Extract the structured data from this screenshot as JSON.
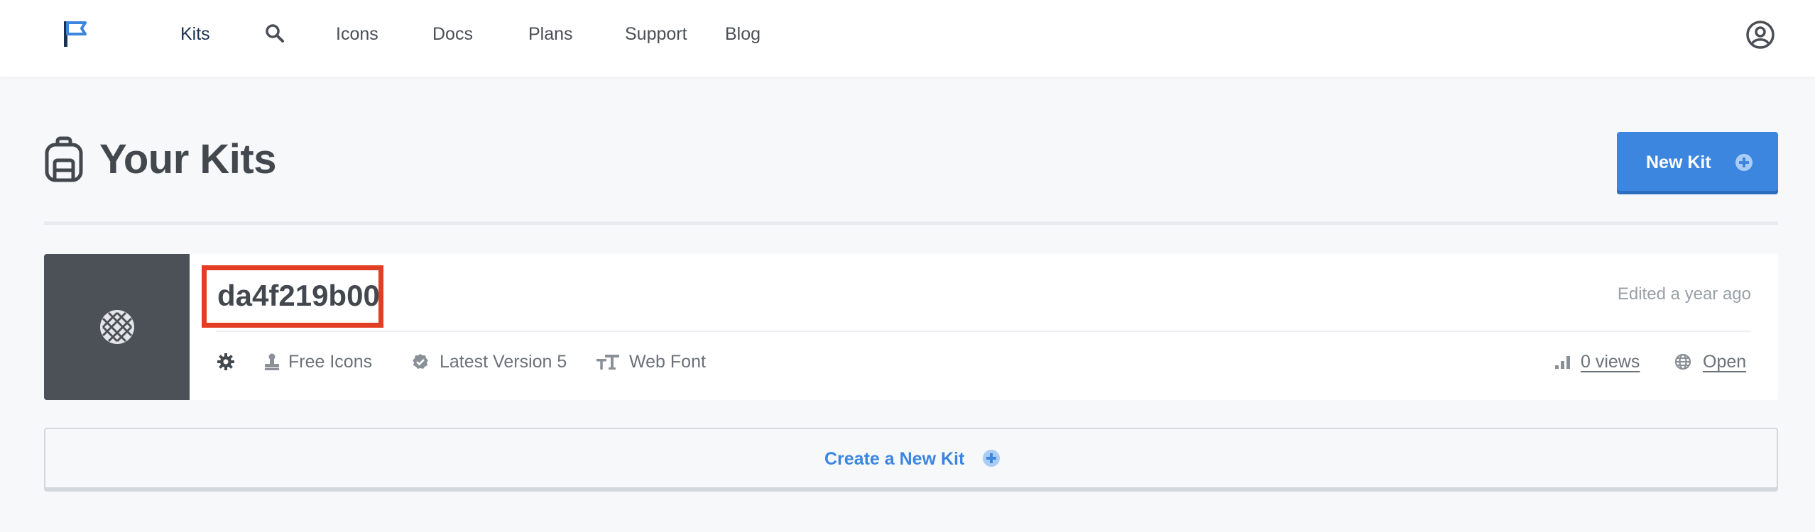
{
  "nav": {
    "items": [
      {
        "label": "Kits",
        "active": true
      },
      {
        "label": "Icons"
      },
      {
        "label": "Docs"
      },
      {
        "label": "Plans"
      },
      {
        "label": "Support"
      },
      {
        "label": "Blog"
      }
    ],
    "icons": {
      "logo": "flag-logo",
      "search": "search-icon",
      "user": "user-circle-icon"
    }
  },
  "header": {
    "title": "Your Kits",
    "icon": "backpack-icon",
    "new_kit_label": "New Kit"
  },
  "kit": {
    "name": "da4f219b00",
    "edited": "Edited a year ago",
    "meta": {
      "plan": "Free Icons",
      "version": "Latest Version 5",
      "tech": "Web Font",
      "views": "0 views",
      "open": "Open"
    }
  },
  "create_label": "Create a New Kit",
  "colors": {
    "accent": "#3c86e0",
    "highlight_box": "#e33e24",
    "thumb_bg": "#4c5157",
    "page_bg": "#f7f8fa"
  }
}
